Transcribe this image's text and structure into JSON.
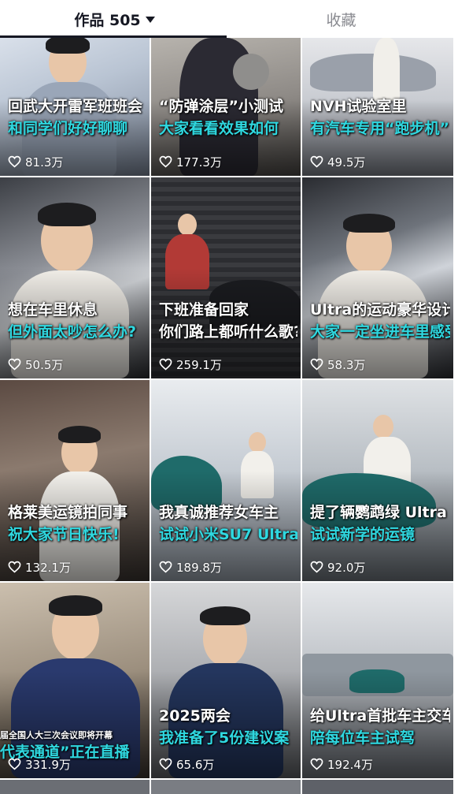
{
  "tabs": {
    "works_label": "作品 505",
    "favorites_label": "收藏"
  },
  "videos": [
    {
      "line1": "回武大开雷军班班会",
      "line2": "和同学们好好聊聊",
      "likes": "81.3万"
    },
    {
      "line1": "“防弹涂层”小测试",
      "line2": "大家看看效果如何",
      "likes": "177.3万"
    },
    {
      "line1": "NVH试验室里",
      "line2": "有汽车专用“跑步机”",
      "likes": "49.5万"
    },
    {
      "line1": "想在车里休息",
      "line2": "但外面太吵怎么办?",
      "likes": "50.5万"
    },
    {
      "line1": "下班准备回家",
      "line2": "你们路上都听什么歌?",
      "likes": "259.1万"
    },
    {
      "line1": "Ultra的运动豪华设计",
      "line2": "大家一定坐进车里感受",
      "likes": "58.3万"
    },
    {
      "line1": "格莱美运镜拍同事",
      "line2": "祝大家节日快乐!",
      "likes": "132.1万"
    },
    {
      "line1": "我真诚推荐女车主",
      "line2": "试试小米SU7 Ultra",
      "likes": "189.8万"
    },
    {
      "line1": "提了辆鹦鹉绿 Ultra",
      "line2": "试试新学的运镜",
      "likes": "92.0万"
    },
    {
      "line1": "届全国人大三次会议即将开幕",
      "line2": "代表通道”正在直播",
      "likes": "331.9万"
    },
    {
      "line1": "2025两会",
      "line2": "我准备了5份建议案",
      "likes": "65.6万"
    },
    {
      "line1": "给Ultra首批车主交车",
      "line2": "陪每位车主试驾",
      "likes": "192.4万"
    }
  ],
  "colors": {
    "caption_white": "#ffffff",
    "caption_cyan": "#2fd8e0",
    "tab_active": "#161823",
    "tab_inactive": "#8a8b91"
  },
  "icons": {
    "like": "heart-outline-icon",
    "dropdown": "caret-down-icon"
  }
}
